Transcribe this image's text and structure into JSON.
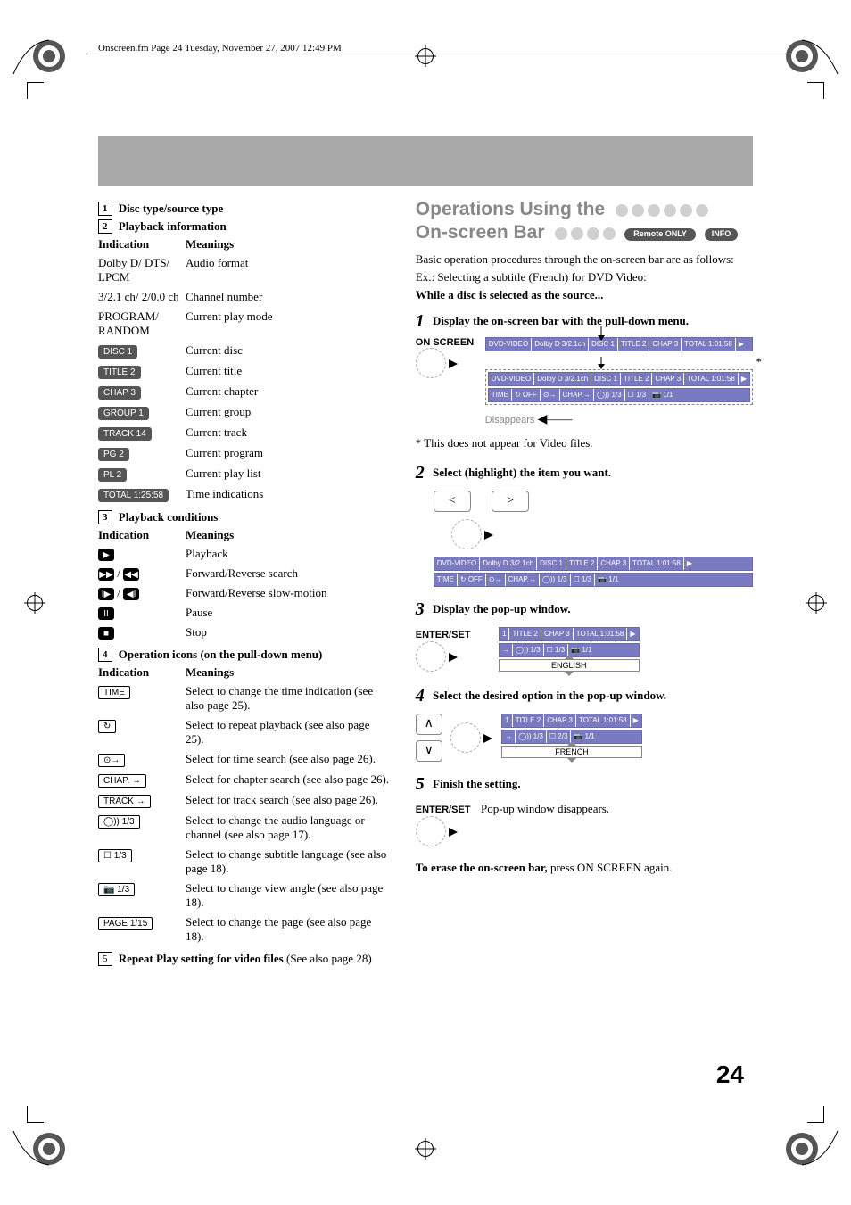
{
  "header_text": "Onscreen.fm  Page 24  Tuesday, November 27, 2007  12:49 PM",
  "left": {
    "s1": {
      "num": "1",
      "title": "Disc type/source type"
    },
    "s2": {
      "num": "2",
      "title": "Playback information",
      "head_ind": "Indication",
      "head_mean": "Meanings",
      "rows": [
        {
          "ind_type": "text",
          "ind": "Dolby D/ DTS/ LPCM",
          "mean": "Audio format"
        },
        {
          "ind_type": "text",
          "ind": "3/2.1 ch/ 2/0.0 ch",
          "mean": "Channel number"
        },
        {
          "ind_type": "text",
          "ind": "PROGRAM/ RANDOM",
          "mean": "Current play mode"
        },
        {
          "ind_type": "chip",
          "ind": "DISC  1",
          "mean": "Current disc"
        },
        {
          "ind_type": "chip",
          "ind": "TITLE  2",
          "mean": "Current title"
        },
        {
          "ind_type": "chip",
          "ind": "CHAP  3",
          "mean": "Current chapter"
        },
        {
          "ind_type": "chip",
          "ind": "GROUP 1",
          "mean": "Current group"
        },
        {
          "ind_type": "chip",
          "ind": "TRACK 14",
          "mean": "Current track"
        },
        {
          "ind_type": "chip",
          "ind": "PG      2",
          "mean": "Current program"
        },
        {
          "ind_type": "chip",
          "ind": "PL      2",
          "mean": "Current play list"
        },
        {
          "ind_type": "chip",
          "ind": "TOTAL 1:25:58",
          "mean": "Time indications"
        }
      ]
    },
    "s3": {
      "num": "3",
      "title": "Playback conditions",
      "head_ind": "Indication",
      "head_mean": "Meanings",
      "rows": [
        {
          "sym": "▶",
          "mean": "Playback"
        },
        {
          "sym": "▶▶ / ◀◀",
          "mean": "Forward/Reverse search"
        },
        {
          "sym": "I▶ / ◀I",
          "mean": "Forward/Reverse slow-motion"
        },
        {
          "sym": "II",
          "mean": "Pause"
        },
        {
          "sym": "■",
          "mean": "Stop"
        }
      ]
    },
    "s4": {
      "num": "4",
      "title": "Operation icons (on the pull-down menu)",
      "head_ind": "Indication",
      "head_mean": "Meanings",
      "rows": [
        {
          "ind": "TIME",
          "mean": "Select to change the time indication (see also page 25)."
        },
        {
          "ind": "↻",
          "mean": "Select to repeat playback (see also page 25)."
        },
        {
          "ind": "⊙→",
          "mean": "Select for time search (see also page 26)."
        },
        {
          "ind": "CHAP. →",
          "mean": "Select for chapter search (see also page 26)."
        },
        {
          "ind": "TRACK →",
          "mean": "Select for track search (see also page 26)."
        },
        {
          "ind": "◯)) 1/3",
          "mean": "Select to change the audio language or channel (see also page 17)."
        },
        {
          "ind": "☐ 1/3",
          "mean": "Select to change subtitle language (see also page 18)."
        },
        {
          "ind": "📷 1/3",
          "mean": "Select to change view angle (see also page 18)."
        },
        {
          "ind": "PAGE 1/15",
          "mean": "Select to change the page (see also page 18)."
        }
      ]
    },
    "s5": {
      "num": "5",
      "title": "Repeat Play setting for video files",
      "tail": " (See also page 28)"
    }
  },
  "right": {
    "title1": "Operations Using the",
    "title2": "On-screen Bar",
    "remote": "Remote ONLY",
    "info": "INFO",
    "intro1": "Basic operation procedures through the on-screen bar are as follows:",
    "intro2": "Ex.: Selecting a subtitle (French) for DVD Video:",
    "intro3": "While a disc is selected as the source...",
    "step1": {
      "n": "1",
      "t": "Display the on-screen bar with the pull-down menu.",
      "label": "ON SCREEN",
      "bar": [
        "DVD-VIDEO",
        "Dolby D 3/2.1ch",
        "DISC 1",
        "TITLE 2",
        "CHAP 3",
        "TOTAL 1:01:58",
        "▶"
      ],
      "bar2a": [
        "DVD-VIDEO",
        "Dolby D 3/2.1ch",
        "DISC 1",
        "TITLE 2",
        "CHAP 3",
        "TOTAL 1:01:58",
        "▶"
      ],
      "bar2b": [
        "TIME",
        "↻ OFF",
        "⊙→",
        "CHAP.→",
        "◯)) 1/3",
        "☐ 1/3",
        "📷 1/1"
      ],
      "disappears": "Disappears",
      "asterisk": "*",
      "foot": "* This does not appear for Video files."
    },
    "step2": {
      "n": "2",
      "t": "Select (highlight) the item you want.",
      "left_btn": "<",
      "right_btn": ">",
      "bar_a": [
        "DVD-VIDEO",
        "Dolby D 3/2.1ch",
        "DISC 1",
        "TITLE 2",
        "CHAP 3",
        "TOTAL 1:01:58",
        "▶"
      ],
      "bar_b": [
        "TIME",
        "↻ OFF",
        "⊙→",
        "CHAP.→",
        "◯)) 1/3",
        "☐ 1/3",
        "📷 1/1"
      ]
    },
    "step3": {
      "n": "3",
      "t": "Display the pop-up window.",
      "label": "ENTER/SET",
      "bar_a": [
        "1",
        "TITLE 2",
        "CHAP 3",
        "TOTAL 1:01:58",
        "▶"
      ],
      "bar_b": [
        "→",
        "◯)) 1/3",
        "☐ 1/3",
        "📷 1/1"
      ],
      "lang": "ENGLISH"
    },
    "step4": {
      "n": "4",
      "t": "Select the desired option in the pop-up window.",
      "up": "∧",
      "down": "∨",
      "bar_a": [
        "1",
        "TITLE 2",
        "CHAP 3",
        "TOTAL 1:01:58",
        "▶"
      ],
      "bar_b": [
        "→",
        "◯)) 1/3",
        "☐ 2/3",
        "📷 1/1"
      ],
      "lang": "FRENCH"
    },
    "step5": {
      "n": "5",
      "t": "Finish the setting.",
      "label": "ENTER/SET",
      "note": "Pop-up window disappears."
    },
    "erase_a": "To erase the on-screen bar,",
    "erase_b": " press ON SCREEN again."
  },
  "page_number": "24"
}
